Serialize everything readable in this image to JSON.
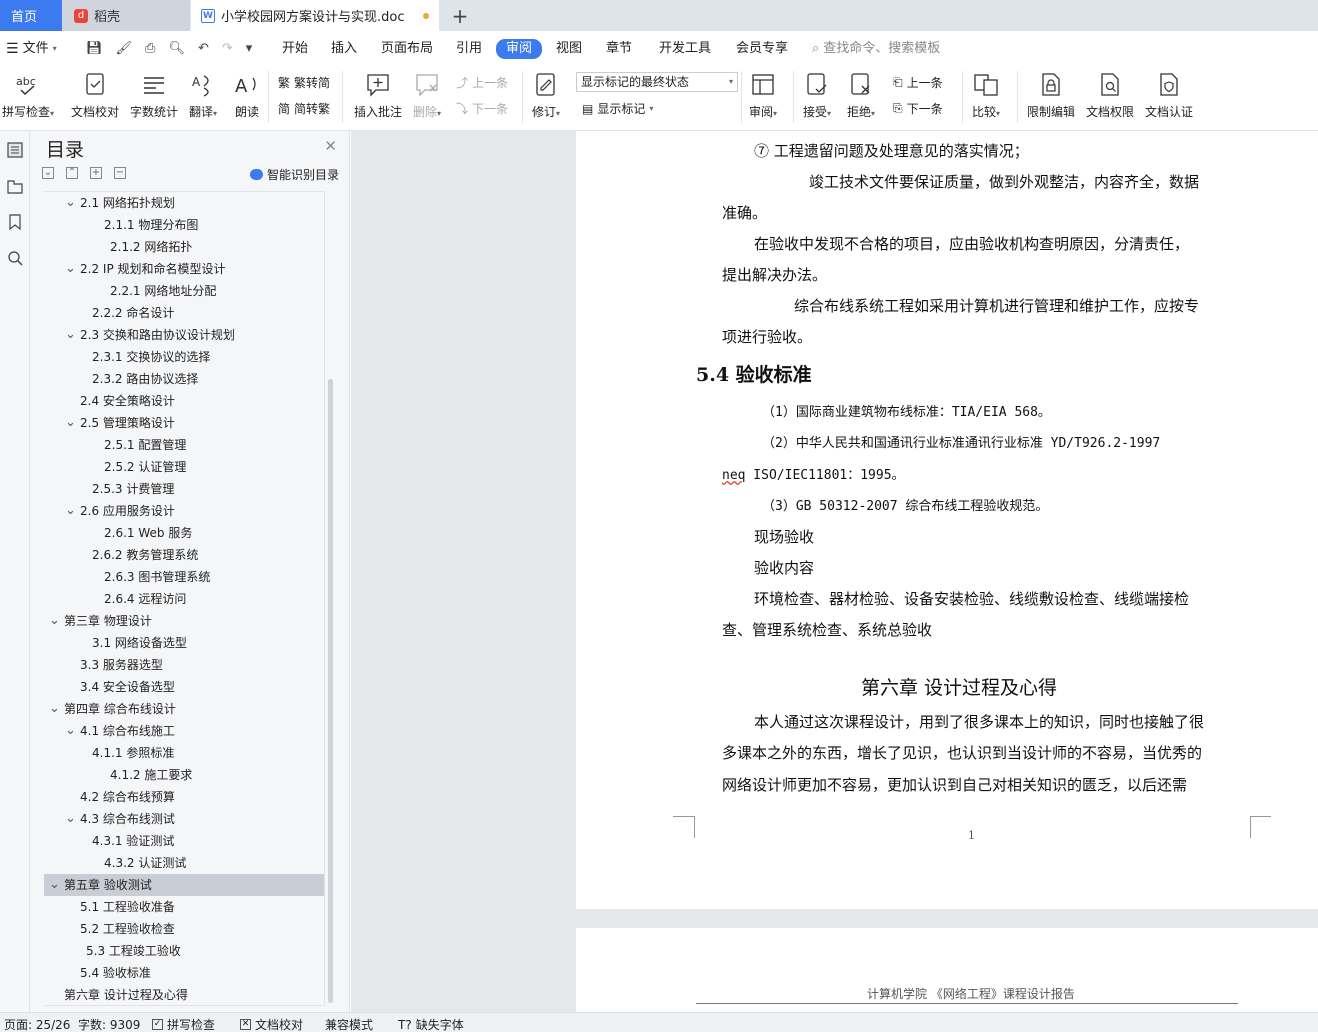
{
  "tabs": {
    "home": "首页",
    "daoke": "稻壳",
    "doc": "小学校园网方案设计与实现.doc",
    "plus": "+"
  },
  "menu": {
    "file": "文件",
    "items": [
      "开始",
      "插入",
      "页面布局",
      "引用",
      "审阅",
      "视图",
      "章节",
      "开发工具",
      "会员专享"
    ],
    "search_placeholder": "查找命令、搜索模板"
  },
  "ribbon": {
    "spell": "拼写检查",
    "proofread": "文档校对",
    "wordcount": "字数统计",
    "translate": "翻译",
    "read": "朗读",
    "to_trad": "繁转简",
    "to_simp": "简转繁",
    "insert_comment": "插入批注",
    "delete": "删除",
    "prev": "上一条",
    "next": "下一条",
    "revise": "修订",
    "mark_state": "显示标记的最终状态",
    "show_marks": "显示标记",
    "review": "审阅",
    "accept": "接受",
    "reject": "拒绝",
    "prev2": "上一条",
    "next2": "下一条",
    "compare": "比较",
    "restrict": "限制编辑",
    "rights": "文档权限",
    "cert": "文档认证"
  },
  "toc": {
    "title": "目录",
    "smart": "智能识别目录",
    "items": [
      {
        "text": "2.1 网络拓扑规划",
        "level": 1,
        "chev": true
      },
      {
        "text": "2.1.1  物理分布图",
        "level": 3
      },
      {
        "text": "2.1.2  网络拓扑",
        "level": 4
      },
      {
        "text": "2.2 IP 规划和命名模型设计",
        "level": 1,
        "chev": true
      },
      {
        "text": "2.2.1  网络地址分配",
        "level": 4
      },
      {
        "text": "2.2.2  命名设计",
        "level": 2
      },
      {
        "text": "2.3  交换和路由协议设计规划",
        "level": 1,
        "chev": true
      },
      {
        "text": "2.3.1  交换协议的选择",
        "level": 2
      },
      {
        "text": "2.3.2  路由协议选择",
        "level": 2
      },
      {
        "text": "2.4  安全策略设计",
        "level": 1
      },
      {
        "text": "2.5  管理策略设计",
        "level": 1,
        "chev": true
      },
      {
        "text": "2.5.1  配置管理",
        "level": 3
      },
      {
        "text": "2.5.2  认证管理",
        "level": 3
      },
      {
        "text": "2.5.3  计费管理",
        "level": 2
      },
      {
        "text": "2.6  应用服务设计",
        "level": 1,
        "chev": true
      },
      {
        "text": "2.6.1 Web 服务",
        "level": 3
      },
      {
        "text": "2.6.2  教务管理系统",
        "level": 2
      },
      {
        "text": "2.6.3  图书管理系统",
        "level": 3
      },
      {
        "text": "2.6.4  远程访问",
        "level": 3
      },
      {
        "text": "第三章  物理设计",
        "level": 0,
        "chev": true
      },
      {
        "text": "3.1  网络设备选型",
        "level": 2
      },
      {
        "text": "3.3  服务器选型",
        "level": 1
      },
      {
        "text": "3.4  安全设备选型",
        "level": 1
      },
      {
        "text": "第四章  综合布线设计",
        "level": 0,
        "chev": true
      },
      {
        "text": "4.1  综合布线施工",
        "level": 1,
        "chev": true
      },
      {
        "text": "4.1.1  参照标准",
        "level": 2
      },
      {
        "text": "4.1.2  施工要求",
        "level": 4
      },
      {
        "text": "4.2  综合布线预算",
        "level": 1
      },
      {
        "text": "4.3  综合布线测试",
        "level": 1,
        "chev": true
      },
      {
        "text": "4.3.1  验证测试",
        "level": 2
      },
      {
        "text": "4.3.2  认证测试",
        "level": 3
      },
      {
        "text": "第五章  验收测试",
        "level": 0,
        "chev": true,
        "selected": true
      },
      {
        "text": "5.1 工程验收准备",
        "level": 1
      },
      {
        "text": "5.2 工程验收检查",
        "level": 1
      },
      {
        "text": "5.3 工程竣工验收",
        "level": 5
      },
      {
        "text": "5.4  验收标准",
        "level": 1
      },
      {
        "text": "第六章  设计过程及心得",
        "level": 0
      }
    ]
  },
  "doc": {
    "l1": "⑦  工程遗留问题及处理意见的落实情况；",
    "l2": "竣工技术文件要保证质量，做到外观整洁，内容齐全，数据",
    "l3": "准确。",
    "l4": "在验收中发现不合格的项目，应由验收机构查明原因，分清责任，",
    "l5": "提出解决办法。",
    "l6": "综合布线系统工程如采用计算机进行管理和维护工作，应按专",
    "l7": "项进行验收。",
    "h54": "5.4  验收标准",
    "s1": "（1）国际商业建筑物布线标准：TIA/EIA 568。",
    "s2": "（2）中华人民共和国通讯行业标准通讯行业标准 YD/T926.2-1997",
    "s3a": "neq",
    "s3b": " ISO/IEC11801：1995。",
    "s4": "（3）GB 50312-2007 综合布线工程验收规范。",
    "p1": "现场验收",
    "p2": "验收内容",
    "p3": "环境检查、器材检验、设备安装检验、线缆敷设检查、线缆端接检",
    "p4": "查、管理系统检查、系统总验收",
    "h6": "第六章  设计过程及心得",
    "q1": "本人通过这次课程设计，用到了很多课本上的知识，同时也接触了很",
    "q2": "多课本之外的东西，增长了见识，也认识到当设计师的不容易，当优秀的",
    "q3": "网络设计师更加不容易，更加认识到自己对相关知识的匮乏，以后还需",
    "page_num": "1",
    "header2": "计算机学院 《网络工程》课程设计报告"
  },
  "status": {
    "page": "页面: 25/26",
    "words": "字数: 9309",
    "spell": "拼写检查",
    "proof": "文档校对",
    "compat": "兼容模式",
    "missing_font": "缺失字体"
  },
  "colors": {
    "accent": "#3c7af0",
    "selected_toc": "#c9cdd5"
  }
}
